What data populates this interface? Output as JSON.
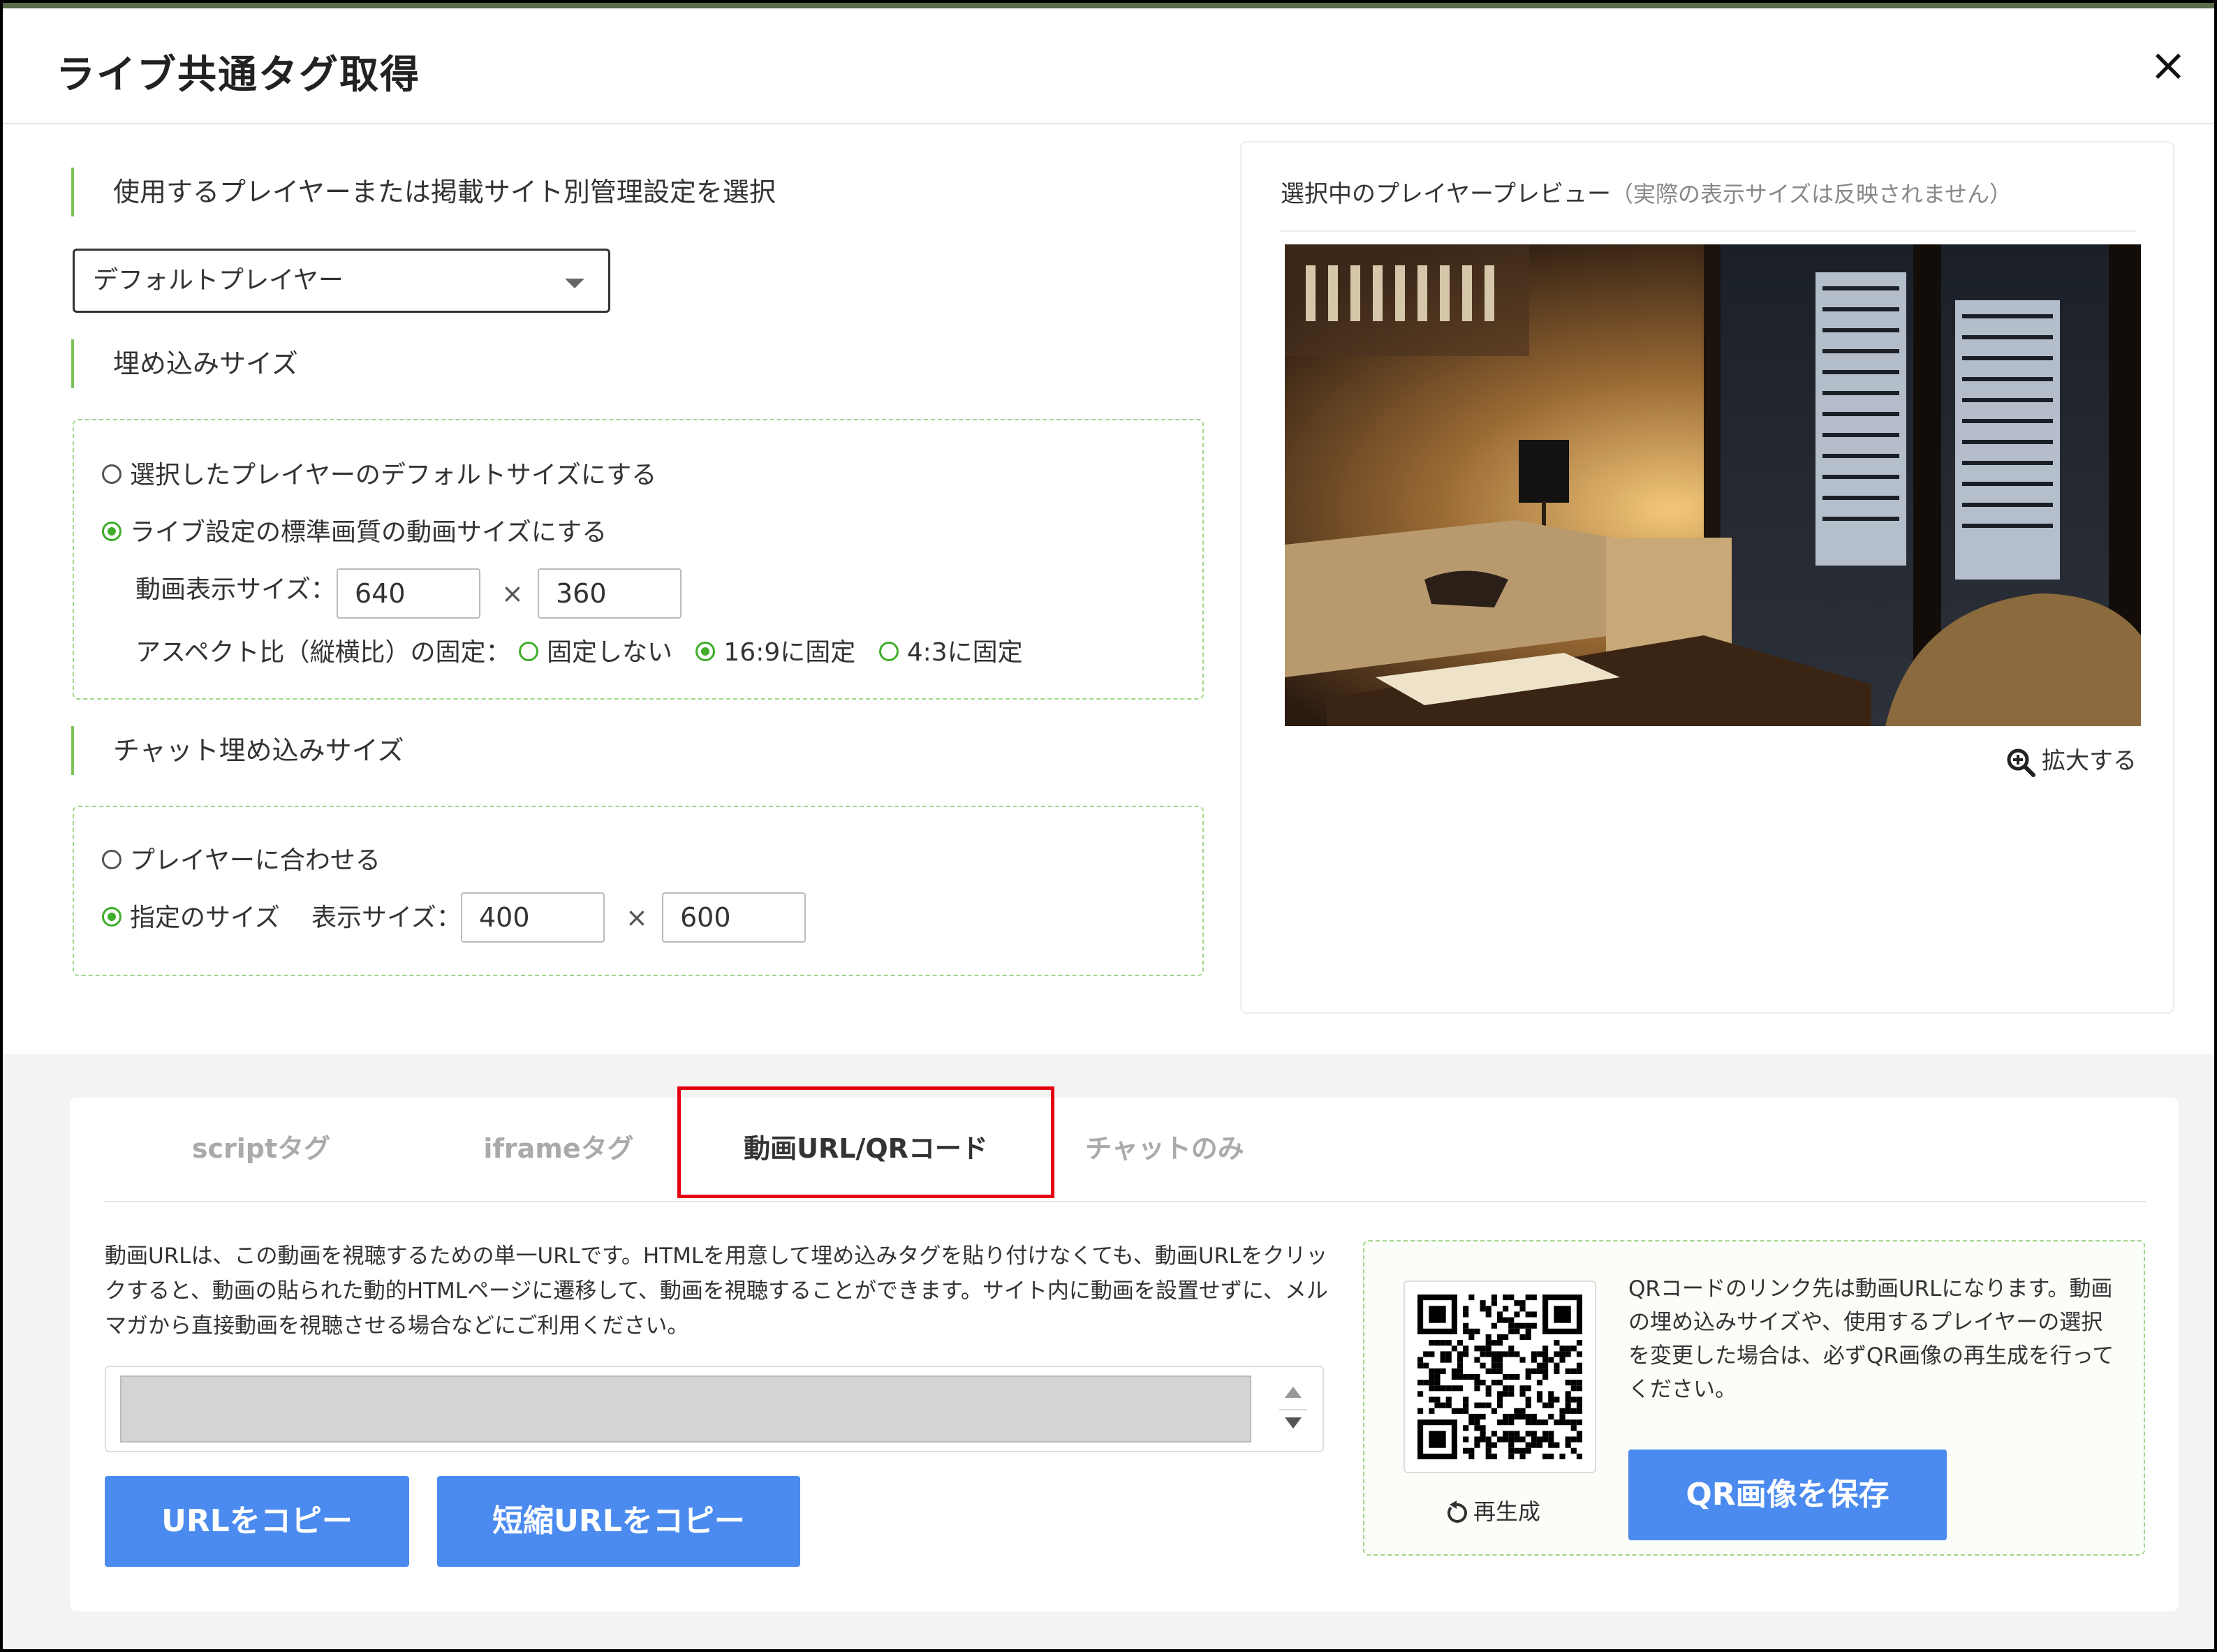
{
  "modal": {
    "title": "ライブ共通タグ取得",
    "close_icon": "×"
  },
  "player_section": {
    "label": "使用するプレイヤーまたは掲載サイト別管理設定を選択",
    "select_value": "デフォルトプレイヤー"
  },
  "embed_size": {
    "label": "埋め込みサイズ",
    "option_default": "選択したプレイヤーのデフォルトサイズにする",
    "option_standard": "ライブ設定の標準画質の動画サイズにする",
    "display_size_label": "動画表示サイズ：",
    "width": "640",
    "height": "360",
    "times": "×",
    "aspect_label": "アスペクト比（縦横比）の固定：",
    "aspect_none": "固定しない",
    "aspect_169": "16:9に固定",
    "aspect_43": "4:3に固定"
  },
  "chat_size": {
    "label": "チャット埋め込みサイズ",
    "option_match": "プレイヤーに合わせる",
    "option_custom": "指定のサイズ",
    "display_size_label": "表示サイズ：",
    "width": "400",
    "height": "600",
    "times": "×"
  },
  "preview": {
    "title": "選択中のプレイヤープレビュー",
    "note": "（実際の表示サイズは反映されません）",
    "zoom_label": "拡大する"
  },
  "tabs": [
    {
      "label": "scriptタグ"
    },
    {
      "label": "iframeタグ"
    },
    {
      "label": "動画URL/QRコード"
    },
    {
      "label": "チャットのみ"
    }
  ],
  "active_tab": "動画URL/QRコード",
  "url_panel": {
    "description": "動画URLは、この動画を視聴するための単一URLです。HTMLを用意して埋め込みタグを貼り付けなくても、動画URLをクリックすると、動画の貼られた動的HTMLページに遷移して、動画を視聴することができます。サイト内に動画を設置せずに、メルマガから直接動画を視聴させる場合などにご利用ください。",
    "url_value": "",
    "copy_url_button": "URLをコピー",
    "copy_short_url_button": "短縮URLをコピー"
  },
  "qr_panel": {
    "regenerate_label": "再生成",
    "description": "QRコードのリンク先は動画URLになります。動画の埋め込みサイズや、使用するプレイヤーの選択を変更した場合は、必ずQR画像の再生成を行ってください。",
    "save_button": "QR画像を保存"
  },
  "colors": {
    "accent_green": "#7cc15a",
    "button_blue": "#4b8bef",
    "highlight_red": "#e60012"
  }
}
